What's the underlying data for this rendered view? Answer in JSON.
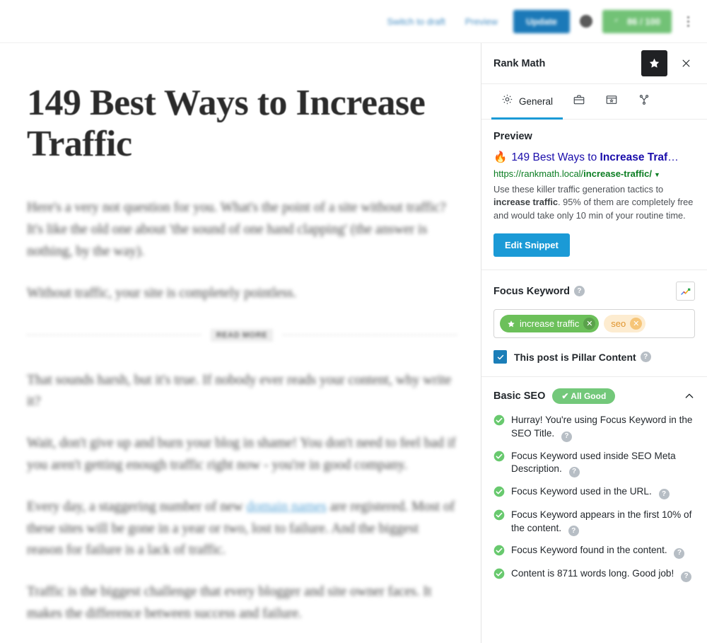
{
  "toolbar": {
    "switch_to_draft": "Switch to draft",
    "preview": "Preview",
    "update": "Update",
    "seo_score": "86 / 100",
    "options_icon": "kebab-menu-icon"
  },
  "editor": {
    "title": "149 Best Ways to Increase Traffic",
    "paragraphs": [
      "Here's a very not question for you. What's the point of a site without traffic? It's like the old one about 'the sound of one hand clapping' (the answer is nothing, by the way).",
      "Without traffic, your site is completely pointless.",
      "That sounds harsh, but it's true. If nobody ever reads your content, why write it?",
      "Wait, don't give up and burn your blog in shame! You don't need to feel bad if you aren't getting enough traffic right now - you're in good company.",
      "Traffic is the biggest challenge that every blogger and site owner faces. It makes the difference between success and failure."
    ],
    "linked_paragraph": {
      "before": "Every day, a staggering number of new ",
      "link": "domain names",
      "after": " are registered. Most of these sites will be gone in a year or two, lost to failure. And the biggest reason for failure is a lack of traffic."
    },
    "read_more_label": "READ MORE"
  },
  "panel": {
    "title": "Rank Math",
    "star_icon": "star-icon",
    "close_icon": "close-icon",
    "tabs": [
      {
        "label": "General",
        "icon": "gear-icon",
        "active": true
      },
      {
        "label": "",
        "icon": "briefcase-icon",
        "active": false
      },
      {
        "label": "",
        "icon": "social-preview-icon",
        "active": false
      },
      {
        "label": "",
        "icon": "share-nodes-icon",
        "active": false
      }
    ],
    "preview": {
      "heading": "Preview",
      "emoji": "🔥",
      "title_plain": "149 Best Ways to ",
      "title_bold": "Increase Traf",
      "title_ellipsis": "…",
      "url_base": "https://rankmath.local/",
      "url_slug": "increase-traffic/",
      "desc_part1": "Use these killer traffic generation tactics to ",
      "desc_bold": "increase traffic",
      "desc_part2": ". 95% of them are completely free and would take only 10 min of your routine time.",
      "edit_snippet_label": "Edit Snippet"
    },
    "focus_keyword": {
      "heading": "Focus Keyword",
      "help_icon": "help-icon",
      "trends_icon": "google-trends-icon",
      "tags": [
        {
          "label": "increase traffic",
          "type": "primary",
          "star": true
        },
        {
          "label": "seo",
          "type": "secondary",
          "star": false
        }
      ],
      "pillar_label": "This post is Pillar Content",
      "pillar_checked": true
    },
    "basic_seo": {
      "heading": "Basic SEO",
      "badge": "✔ All Good",
      "collapse_icon": "chevron-up-icon",
      "items": [
        "Hurray! You're using Focus Keyword in the SEO Title.",
        "Focus Keyword used inside SEO Meta Description.",
        "Focus Keyword used in the URL.",
        "Focus Keyword appears in the first 10% of the content.",
        "Focus Keyword found in the content.",
        "Content is 8711 words long. Good job!"
      ]
    }
  },
  "colors": {
    "accent_blue": "#1b9ad6",
    "update_blue": "#1b79b8",
    "success_green": "#73c87a",
    "keyword_green": "#6cc05a",
    "keyword_orange": "#fdecd0",
    "link_blue": "#1a0dab",
    "url_green": "#0b7d22",
    "checkbox_blue": "#1b7eb8"
  }
}
